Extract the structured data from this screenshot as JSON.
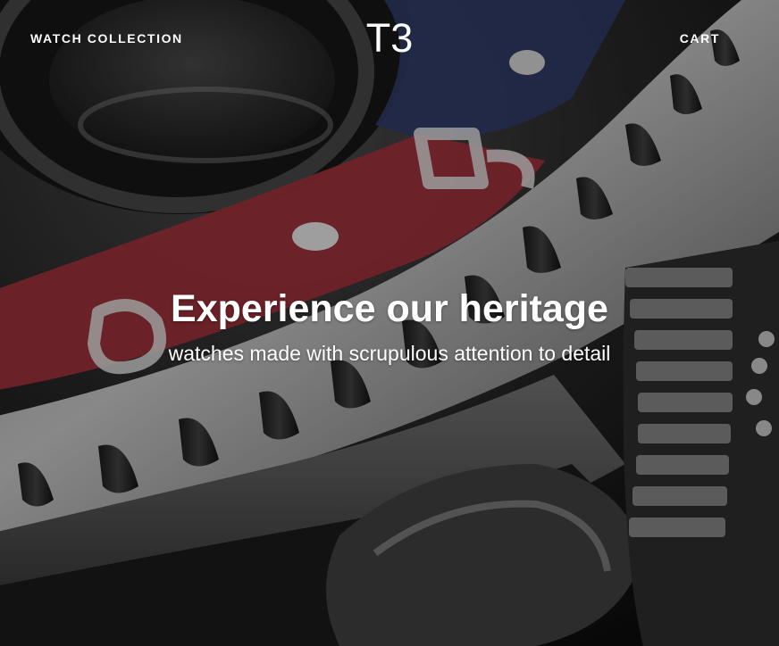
{
  "nav": {
    "left_link": "WATCH COLLECTION",
    "logo": "T3",
    "right_link": "CART"
  },
  "hero": {
    "headline": "Experience our heritage",
    "subheadline": "watches made with scrupulous attention to detail",
    "image_icon": "watch-bezel-closeup-image"
  },
  "colors": {
    "text": "#ffffff",
    "bezel_red": "#9a2f39",
    "bezel_blue": "#2f3a66",
    "overlay": "#000000"
  }
}
